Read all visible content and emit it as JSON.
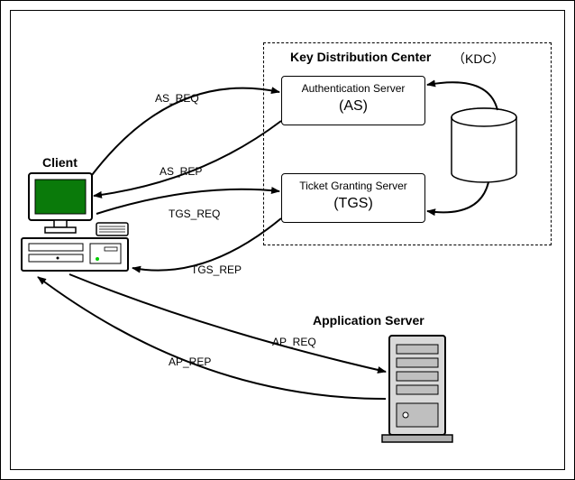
{
  "kdc": {
    "title": "Key Distribution Center",
    "abbr": "（KDC）",
    "as": {
      "name": "Authentication Server",
      "abbr": "(AS)"
    },
    "tgs": {
      "name": "Ticket Granting Server",
      "abbr": "(TGS)"
    },
    "db": "DATABASE"
  },
  "client": {
    "title": "Client"
  },
  "appserver": {
    "title": "Application Server"
  },
  "messages": {
    "as_req": "AS_REQ",
    "as_rep": "AS_REP",
    "tgs_req": "TGS_REQ",
    "tgs_rep": "TGS_REP",
    "ap_req": "AP_REQ",
    "ap_rep": "AP_REP"
  }
}
